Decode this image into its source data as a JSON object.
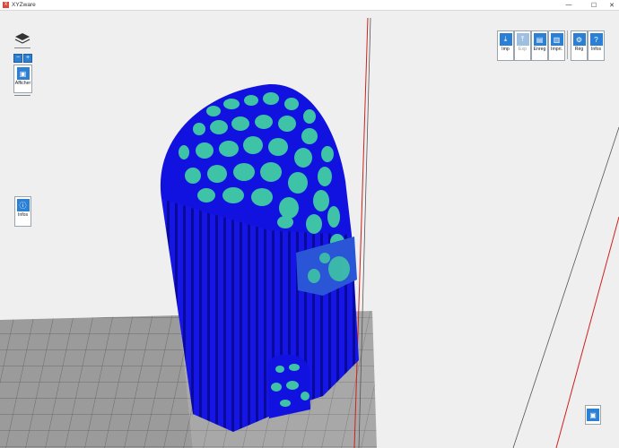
{
  "window": {
    "title": "XYZware",
    "controls": [
      "—",
      "☐",
      "✕"
    ]
  },
  "left_toolbar": {
    "zoom_out": "−",
    "zoom_in": "+",
    "view_label": "Afficher",
    "info_label": "Infos"
  },
  "top_toolbar": {
    "items": [
      {
        "label": "Imp",
        "icon": "import-icon",
        "enabled": true
      },
      {
        "label": "Exp",
        "icon": "export-icon",
        "enabled": false
      },
      {
        "label": "Enreg",
        "icon": "save-icon",
        "enabled": true
      },
      {
        "label": "Impri.",
        "icon": "print-icon",
        "enabled": true
      },
      {
        "label": "Rég",
        "icon": "settings-icon",
        "enabled": true
      },
      {
        "label": "Infos",
        "icon": "info-icon",
        "enabled": true
      }
    ]
  },
  "bottom_right": {
    "icon": "printer-status-icon"
  },
  "colors": {
    "background": "#f0f0f0",
    "accent": "#2b7fd4",
    "model_blue": "#1010e0",
    "model_teal": "#40c0a8",
    "build_line": "#d02020",
    "grid": "#8a8a8a"
  }
}
